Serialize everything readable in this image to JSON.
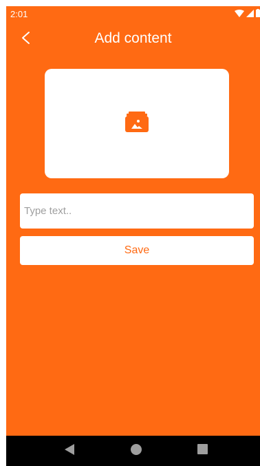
{
  "status_bar": {
    "time": "2:01",
    "icons": [
      "wifi-icon",
      "signal-icon",
      "battery-icon"
    ]
  },
  "header": {
    "title": "Add content",
    "back_icon": "back-arrow-icon"
  },
  "image_picker": {
    "icon": "image-folder-icon"
  },
  "text_field": {
    "placeholder": "Type text..",
    "value": ""
  },
  "save_button": {
    "label": "Save"
  },
  "nav_bar": {
    "icons": [
      "nav-back-icon",
      "nav-home-icon",
      "nav-recents-icon"
    ]
  },
  "colors": {
    "accent": "#FF6A13",
    "surface": "#FFFFFF",
    "nav_bar": "#000000"
  }
}
